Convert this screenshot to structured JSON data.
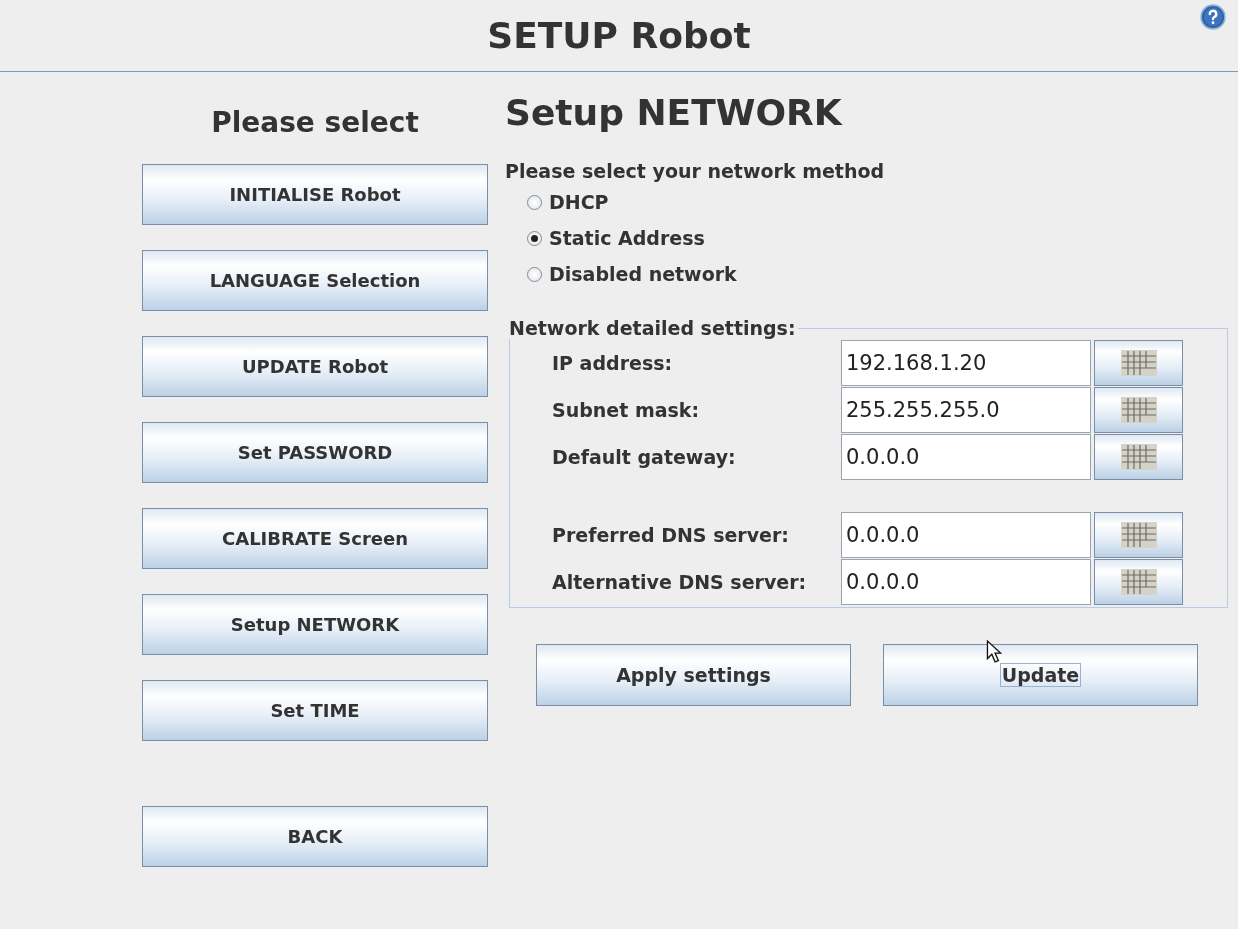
{
  "header": {
    "title": "SETUP Robot"
  },
  "sidebar": {
    "title": "Please select",
    "items": [
      {
        "label": "INITIALISE Robot",
        "kind": "menu"
      },
      {
        "label": "LANGUAGE Selection",
        "kind": "menu"
      },
      {
        "label": "UPDATE Robot",
        "kind": "menu"
      },
      {
        "label": "Set PASSWORD",
        "kind": "menu"
      },
      {
        "label": "CALIBRATE Screen",
        "kind": "menu"
      },
      {
        "label": "Setup NETWORK",
        "kind": "menu"
      },
      {
        "label": "Set TIME",
        "kind": "menu"
      },
      {
        "label": "BACK",
        "kind": "back"
      }
    ]
  },
  "main": {
    "title": "Setup NETWORK",
    "prompt": "Please select your network method",
    "methods": [
      {
        "label": "DHCP",
        "selected": false
      },
      {
        "label": "Static Address",
        "selected": true
      },
      {
        "label": "Disabled network",
        "selected": false
      }
    ],
    "settings": {
      "legend": "Network detailed settings:",
      "groups": [
        {
          "fields": [
            {
              "label": "IP address:",
              "value": "192.168.1.20"
            },
            {
              "label": "Subnet mask:",
              "value": "255.255.255.0"
            },
            {
              "label": "Default gateway:",
              "value": "0.0.0.0"
            }
          ]
        },
        {
          "fields": [
            {
              "label": "Preferred DNS server:",
              "value": "0.0.0.0"
            },
            {
              "label": "Alternative DNS server:",
              "value": "0.0.0.0"
            }
          ]
        }
      ]
    },
    "buttons": [
      {
        "label": "Apply settings",
        "focused": false
      },
      {
        "label": "Update",
        "focused": true
      }
    ]
  }
}
